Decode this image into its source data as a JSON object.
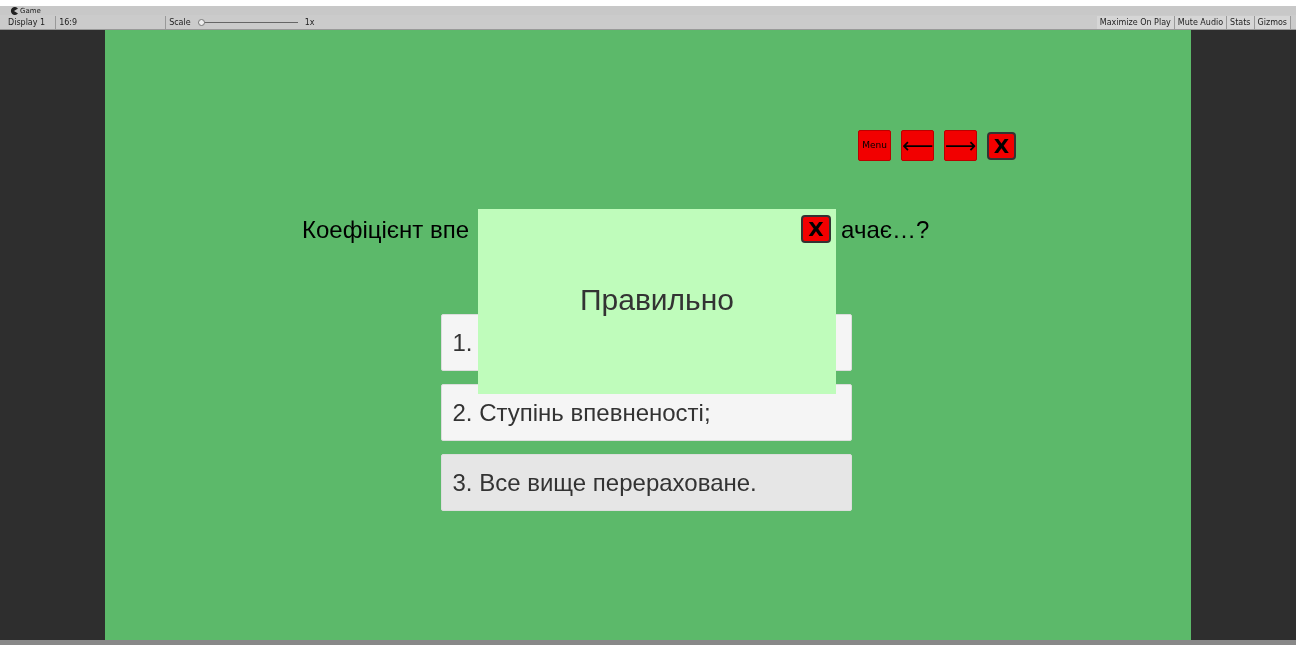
{
  "editor": {
    "tab_title": "Game",
    "display": "Display 1",
    "aspect": "16:9",
    "scale_label": "Scale",
    "scale_value": "1x",
    "scale_slider": {
      "level": 0
    },
    "toolbar_buttons": [
      "Maximize On Play",
      "Mute Audio",
      "Stats",
      "Gizmos"
    ]
  },
  "game": {
    "nav_buttons": [
      {
        "kind": "text",
        "label": "Menu"
      },
      {
        "kind": "text",
        "label": "⟵"
      },
      {
        "kind": "text",
        "label": "⟶"
      },
      {
        "kind": "close",
        "label": "X"
      }
    ],
    "question_parts": [
      "Коефіцієнт впе",
      "ачає…?"
    ],
    "answers": [
      "1.",
      "2. Ступінь впевненості;",
      "3. Все вище перераховане."
    ],
    "popup": {
      "message": "Правильно",
      "close_label": "X"
    }
  }
}
